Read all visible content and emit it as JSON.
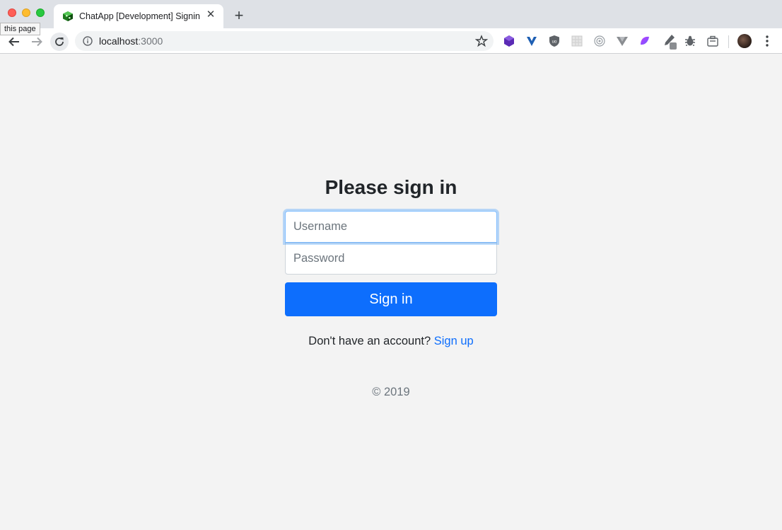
{
  "browser": {
    "tab_title": "ChatApp [Development] Signin",
    "tab_close": "✕",
    "new_tab": "+",
    "tooltip": "this page",
    "url_host": "localhost",
    "url_port": ":3000",
    "extensions": [
      "purple-cube-extension",
      "vue-devtools-extension",
      "ublock-extension",
      "grid-extension",
      "target-extension",
      "vue-triangle-extension",
      "gradient-extension",
      "eyedropper-extension",
      "bug-extension",
      "briefcase-extension"
    ]
  },
  "signin": {
    "title": "Please sign in",
    "username_placeholder": "Username",
    "password_placeholder": "Password",
    "submit_label": "Sign in",
    "no_account_text": "Don't have an account? ",
    "signup_link": "Sign up",
    "copyright": "© 2019"
  },
  "colors": {
    "primary": "#0d6efd",
    "page_bg": "#f3f3f3"
  }
}
